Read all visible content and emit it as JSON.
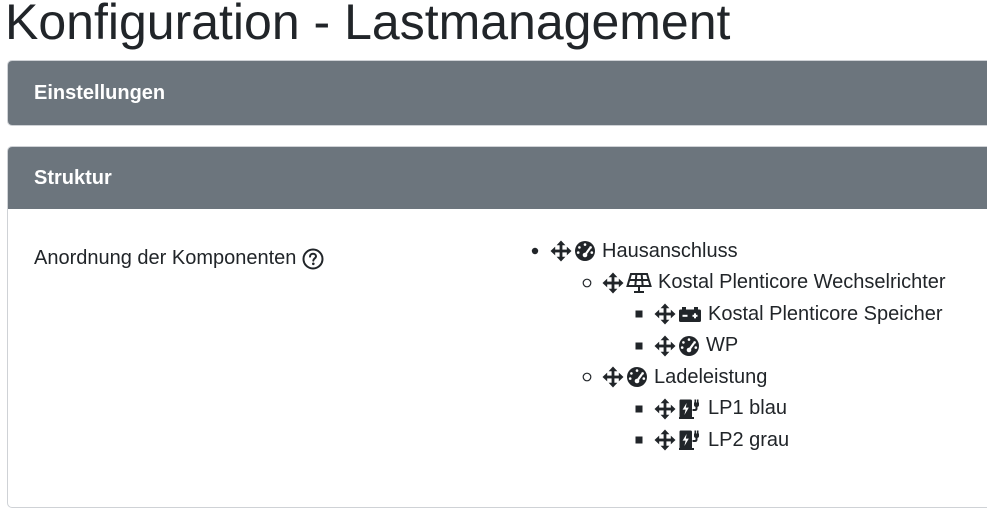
{
  "page_title": "Konfiguration - Lastmanagement",
  "cards": {
    "einstellungen": {
      "header": "Einstellungen"
    },
    "struktur": {
      "header": "Struktur",
      "field_label": "Anordnung der Komponenten",
      "help_icon": "question-circle-icon",
      "tree": [
        {
          "level": 1,
          "bullet": "disc",
          "icon": "gauge-icon",
          "label": "Hausanschluss"
        },
        {
          "level": 2,
          "bullet": "circle",
          "icon": "solar-panel-icon",
          "label": "Kostal Plenticore Wechselrichter"
        },
        {
          "level": 3,
          "bullet": "square",
          "icon": "battery-icon",
          "label": "Kostal Plenticore Speicher"
        },
        {
          "level": 3,
          "bullet": "square",
          "icon": "gauge-icon",
          "label": "WP"
        },
        {
          "level": 2,
          "bullet": "circle",
          "icon": "gauge-icon",
          "label": "Ladeleistung"
        },
        {
          "level": 3,
          "bullet": "square",
          "icon": "charging-station-icon",
          "label": "LP1 blau"
        },
        {
          "level": 3,
          "bullet": "square",
          "icon": "charging-station-icon",
          "label": "LP2 grau"
        }
      ]
    }
  }
}
